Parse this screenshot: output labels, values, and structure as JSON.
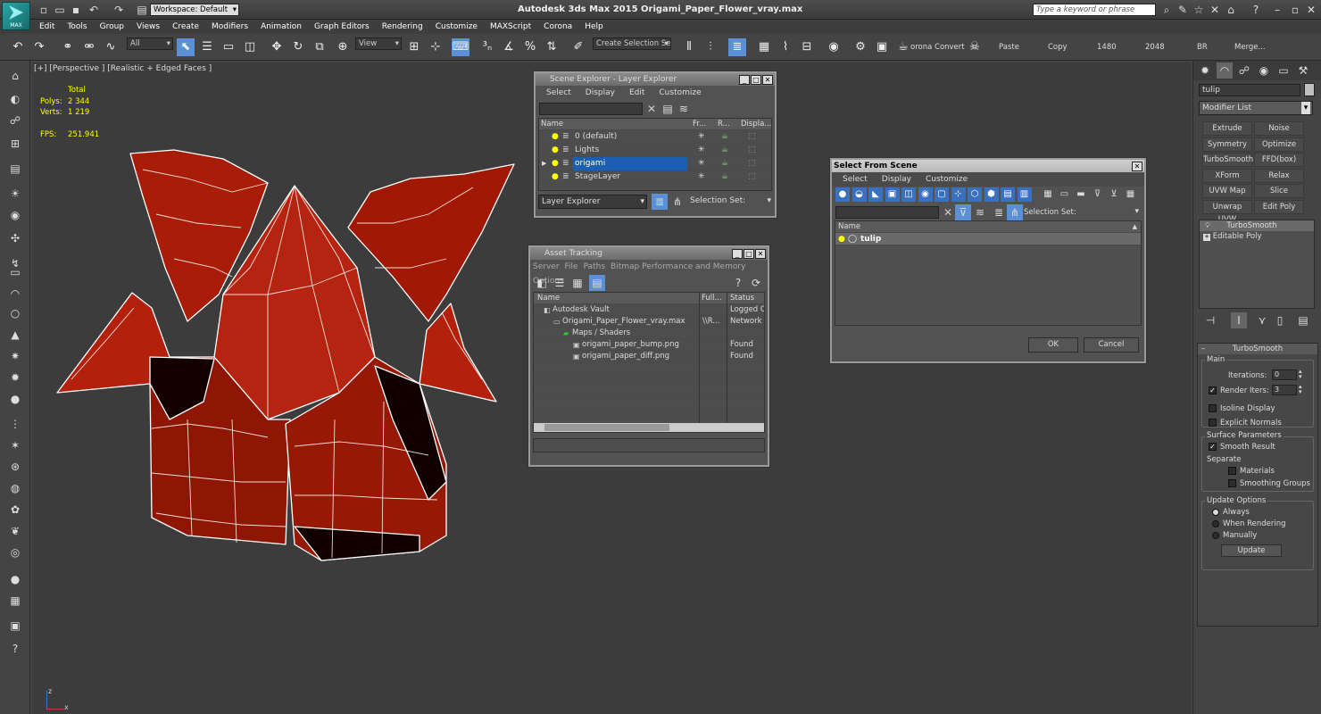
{
  "app": {
    "title": "Autodesk 3ds Max  2015   Origami_Paper_Flower_vray.max",
    "logo_text": "MAX",
    "workspace": "Workspace: Default",
    "search_placeholder": "Type a keyword or phrase"
  },
  "menu": [
    "Edit",
    "Tools",
    "Group",
    "Views",
    "Create",
    "Modifiers",
    "Animation",
    "Graph Editors",
    "Rendering",
    "Customize",
    "MAXScript",
    "Corona",
    "Help"
  ],
  "toolbar": {
    "filter": "All",
    "view": "View",
    "create_selection_set": "Create Selection Se",
    "corona_convert": "orona Convert",
    "paste": "Paste",
    "copy": "Copy",
    "w1480": "1480",
    "w2048": "2048",
    "br": "BR",
    "merge": "Merge..."
  },
  "viewport": {
    "label": "[+] [Perspective ] [Realistic + Edged Faces ]",
    "stats_total": "Total",
    "polys_label": "Polys:",
    "polys_value": "2 344",
    "verts_label": "Verts:",
    "verts_value": "1 219",
    "fps_label": "FPS:",
    "fps_value": "251.941",
    "axis_z": "z",
    "axis_x": "x"
  },
  "scene_explorer": {
    "title": "Scene Explorer - Layer Explorer",
    "menus": [
      "Select",
      "Display",
      "Edit",
      "Customize"
    ],
    "columns": [
      "Name",
      "Fr...",
      "R...",
      "Displa..."
    ],
    "layers": [
      {
        "name": "0 (default)"
      },
      {
        "name": "Lights"
      },
      {
        "name": "origami",
        "selected": true
      },
      {
        "name": "StageLayer"
      }
    ],
    "dropdown": "Layer Explorer",
    "selection_set_label": "Selection Set:"
  },
  "asset_tracking": {
    "title": "Asset Tracking",
    "menus": [
      "Server",
      "File",
      "Paths",
      "Bitmap Performance and Memory",
      "Options"
    ],
    "columns": [
      "Name",
      "Full...",
      "Status"
    ],
    "rows": [
      {
        "name": "Autodesk Vault",
        "full": "",
        "status": "Logged Ou",
        "indent": 1
      },
      {
        "name": "Origami_Paper_Flower_vray.max",
        "full": "\\\\R...",
        "status": "Network P",
        "indent": 2
      },
      {
        "name": "Maps / Shaders",
        "full": "",
        "status": "",
        "indent": 3
      },
      {
        "name": "origami_paper_bump.png",
        "full": "",
        "status": "Found",
        "indent": 4
      },
      {
        "name": "origami_paper_diff.png",
        "full": "",
        "status": "Found",
        "indent": 4
      }
    ]
  },
  "select_from_scene": {
    "title": "Select From Scene",
    "menus": [
      "Select",
      "Display",
      "Customize"
    ],
    "selection_set_label": "Selection Set:",
    "column": "Name",
    "items": [
      {
        "name": "tulip"
      }
    ],
    "ok": "OK",
    "cancel": "Cancel"
  },
  "command_panel": {
    "object_name": "tulip",
    "modifier_list": "Modifier List",
    "buttons": [
      "Extrude",
      "Noise",
      "Symmetry",
      "Optimize",
      "TurboSmooth",
      "FFD(box)",
      "XForm",
      "Relax",
      "UVW Map",
      "Slice",
      "Unwrap UVW",
      "Edit Poly"
    ],
    "stack": [
      "TurboSmooth",
      "Editable Poly"
    ],
    "rollout": {
      "title": "TurboSmooth",
      "main": "Main",
      "iterations_label": "Iterations:",
      "iterations_value": "0",
      "render_iters_label": "Render Iters:",
      "render_iters_value": "3",
      "isoline": "Isoline Display",
      "explicit_normals": "Explicit Normals",
      "surface_params": "Surface Parameters",
      "smooth_result": "Smooth Result",
      "separate": "Separate",
      "materials": "Materials",
      "smoothing_groups": "Smoothing Groups",
      "update_options": "Update Options",
      "always": "Always",
      "when_rendering": "When Rendering",
      "manually": "Manually",
      "update": "Update"
    }
  },
  "colors": {
    "flower_red": "#a81c08",
    "edge": "#ffffff",
    "selection_blue": "#1a5fb4"
  }
}
